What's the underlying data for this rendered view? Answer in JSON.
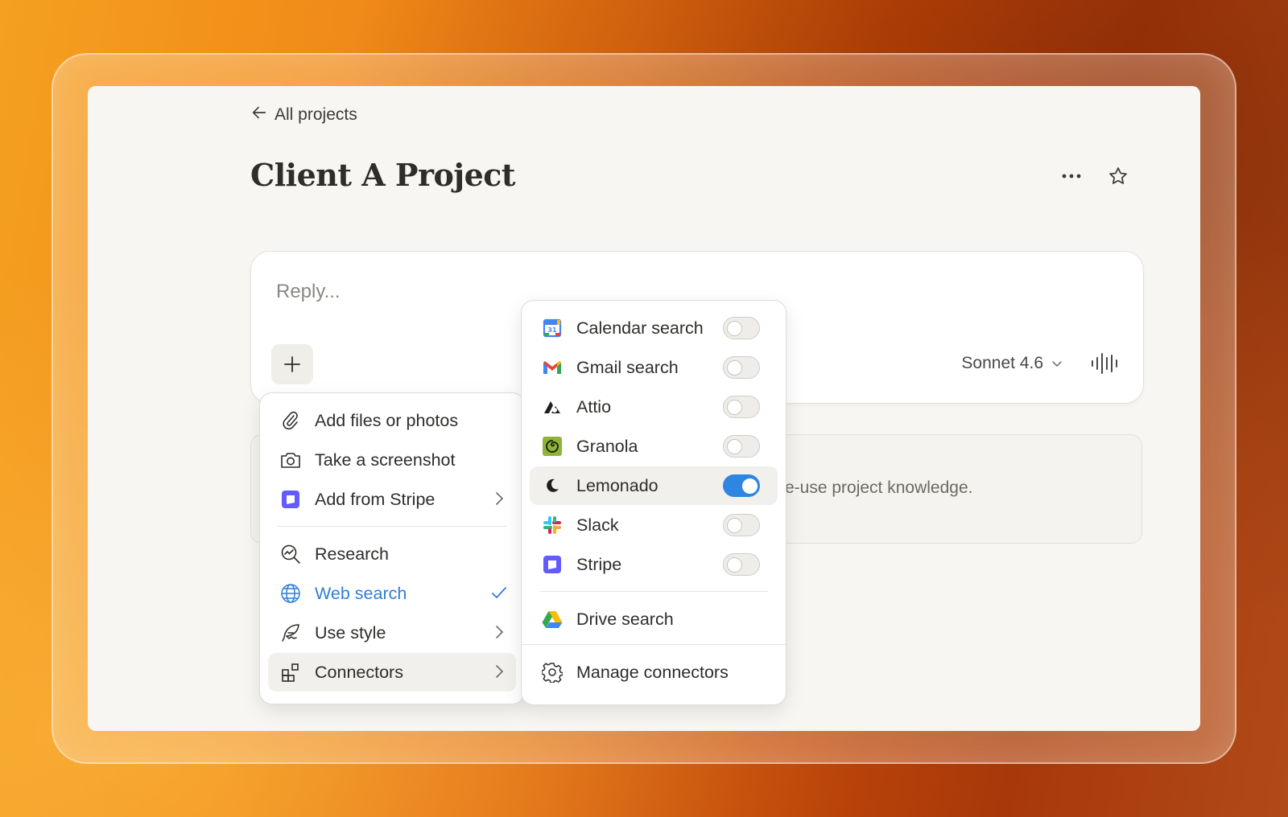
{
  "nav": {
    "back_label": "All projects"
  },
  "project": {
    "title": "Client A Project"
  },
  "composer": {
    "placeholder": "Reply...",
    "model_label": "Sonnet 4.6"
  },
  "knowledge": {
    "text": "re-use project knowledge."
  },
  "tools_menu": {
    "items": [
      {
        "label": "Add files or photos",
        "icon": "paperclip-icon"
      },
      {
        "label": "Take a screenshot",
        "icon": "camera-icon"
      },
      {
        "label": "Add from Stripe",
        "icon": "stripe-icon",
        "submenu": true
      },
      {
        "label": "Research",
        "icon": "research-icon"
      },
      {
        "label": "Web search",
        "icon": "globe-icon",
        "checked": true
      },
      {
        "label": "Use style",
        "icon": "quill-icon",
        "submenu": true
      },
      {
        "label": "Connectors",
        "icon": "connectors-icon",
        "submenu": true,
        "highlighted": true
      }
    ]
  },
  "connectors_menu": {
    "items": [
      {
        "label": "Calendar search",
        "icon": "google-calendar-icon",
        "enabled": false
      },
      {
        "label": "Gmail search",
        "icon": "gmail-icon",
        "enabled": false
      },
      {
        "label": "Attio",
        "icon": "attio-icon",
        "enabled": false
      },
      {
        "label": "Granola",
        "icon": "granola-icon",
        "enabled": false
      },
      {
        "label": "Lemonado",
        "icon": "lemonado-icon",
        "enabled": true
      },
      {
        "label": "Slack",
        "icon": "slack-icon",
        "enabled": false
      },
      {
        "label": "Stripe",
        "icon": "stripe-icon",
        "enabled": false
      }
    ],
    "drive_label": "Drive search",
    "manage_label": "Manage connectors"
  },
  "colors": {
    "accent_blue": "#2f86e0",
    "stripe_purple": "#635bff",
    "window_bg": "#f7f6f2"
  }
}
